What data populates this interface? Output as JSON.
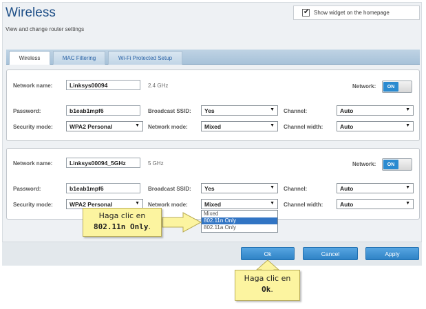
{
  "header": {
    "title": "Wireless",
    "subtitle": "View and change router settings",
    "widget_label": "Show widget on the homepage"
  },
  "tabs": [
    {
      "label": "Wireless",
      "active": true
    },
    {
      "label": "MAC Filtering",
      "active": false
    },
    {
      "label": "Wi-Fi Protected Setup",
      "active": false
    }
  ],
  "band_24": {
    "network_name_label": "Network name:",
    "network_name": "Linksys00094",
    "band": "2.4 GHz",
    "network_toggle_label": "Network:",
    "network_toggle_value": "ON",
    "password_label": "Password:",
    "password": "b1eab1mpf6",
    "broadcast_label": "Broadcast SSID:",
    "broadcast": "Yes",
    "channel_label": "Channel:",
    "channel": "Auto",
    "security_label": "Security mode:",
    "security": "WPA2 Personal",
    "mode_label": "Network mode:",
    "mode": "Mixed",
    "width_label": "Channel width:",
    "width": "Auto"
  },
  "band_5": {
    "network_name_label": "Network name:",
    "network_name": "Linksys00094_5GHz",
    "band": "5 GHz",
    "network_toggle_label": "Network:",
    "network_toggle_value": "ON",
    "password_label": "Password:",
    "password": "b1eab1mpf6",
    "broadcast_label": "Broadcast SSID:",
    "broadcast": "Yes",
    "channel_label": "Channel:",
    "channel": "Auto",
    "security_label": "Security mode:",
    "security": "WPA2 Personal",
    "mode_label": "Network mode:",
    "mode": "Mixed",
    "width_label": "Channel width:",
    "width": "Auto",
    "mode_options": [
      "Mixed",
      "802.11n Only",
      "802.11a Only"
    ],
    "mode_highlighted": "802.11n Only"
  },
  "buttons": {
    "ok": "Ok",
    "cancel": "Cancel",
    "apply": "Apply"
  },
  "callouts": {
    "mode": {
      "line1": "Haga clic en",
      "line2": "802.11n Only",
      "suffix": "."
    },
    "ok": {
      "line1": "Haga clic en",
      "line2": "Ok",
      "suffix": "."
    }
  },
  "colors": {
    "title": "#1e4f87",
    "accent": "#2f82c5",
    "callout": "#fcf4a0"
  }
}
